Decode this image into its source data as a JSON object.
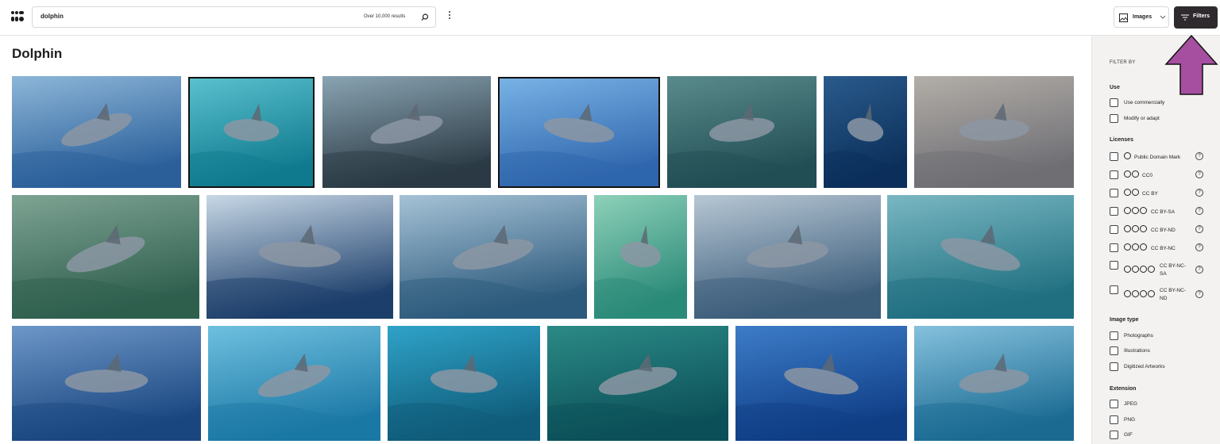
{
  "header": {
    "search_value": "dolphin",
    "results_count": "Over 10,000 results",
    "content_type": "Images",
    "filters_label": "Filters"
  },
  "main": {
    "title": "Dolphin",
    "images": [
      {
        "scene": "pod-calm"
      },
      {
        "scene": "splash-selected"
      },
      {
        "scene": "orcas"
      },
      {
        "scene": "closeup-selected"
      },
      {
        "scene": "open-mouth"
      },
      {
        "scene": "bow-riding"
      },
      {
        "scene": "pair-leaping"
      },
      {
        "scene": "leaping-green"
      },
      {
        "scene": "wave-surfing"
      },
      {
        "scene": "dark-jump"
      },
      {
        "scene": "pool-smile"
      },
      {
        "scene": "spray-pair"
      },
      {
        "scene": "teal-jump"
      },
      {
        "scene": "pod-blue"
      },
      {
        "scene": "small-leap"
      },
      {
        "scene": "underwater-closeup"
      },
      {
        "scene": "diver-pair"
      },
      {
        "scene": "deep-blue-leap"
      },
      {
        "scene": "group-turquoise"
      }
    ]
  },
  "sidebar": {
    "filter_by": "FILTER BY",
    "sections": {
      "use": {
        "title": "Use",
        "options": [
          "Use commercially",
          "Modify or adapt"
        ]
      },
      "licenses": {
        "title": "Licenses",
        "options": [
          "Public Domain Mark",
          "CC0",
          "CC BY",
          "CC BY-SA",
          "CC BY-ND",
          "CC BY-NC",
          "CC BY-NC-SA",
          "CC BY-NC-ND"
        ]
      },
      "image_type": {
        "title": "Image type",
        "options": [
          "Photographs",
          "Illustrations",
          "Digitized Artworks"
        ]
      },
      "extension": {
        "title": "Extension",
        "options": [
          "JPEG",
          "PNG",
          "GIF"
        ]
      }
    },
    "license_lines": {
      "nc_sa_1": "CC BY-NC-",
      "nc_sa_2": "SA",
      "nc_nd_1": "CC BY-NC-",
      "nc_nd_2": "ND"
    },
    "help_glyph": "?"
  },
  "colors": {
    "accent": "#2f2a2d",
    "arrow": "#a64fa0"
  }
}
